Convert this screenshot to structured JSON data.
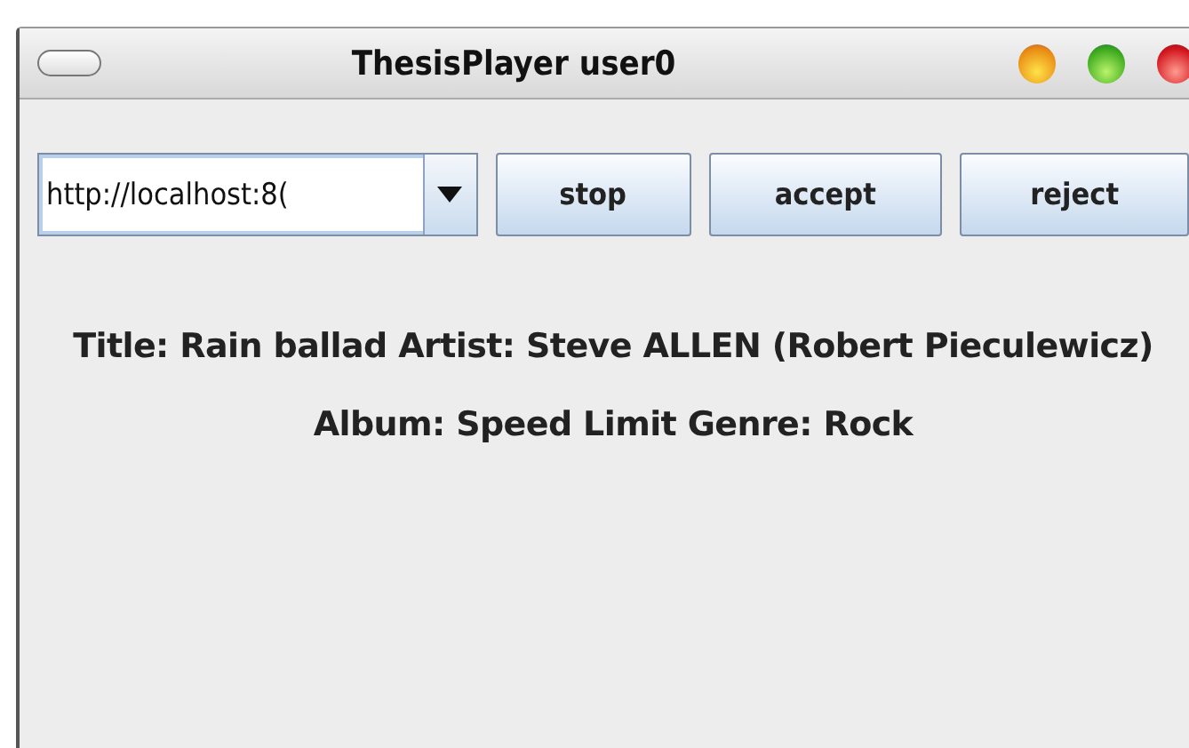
{
  "window": {
    "title": "ThesisPlayer user0"
  },
  "url_combo": {
    "value": "http://localhost:8("
  },
  "buttons": [
    "stop",
    "accept",
    "reject"
  ],
  "info_lines": [
    "Title: Rain ballad Artist: Steve ALLEN (Robert Pieculewicz)",
    "Album: Speed Limit Genre: Rock"
  ]
}
